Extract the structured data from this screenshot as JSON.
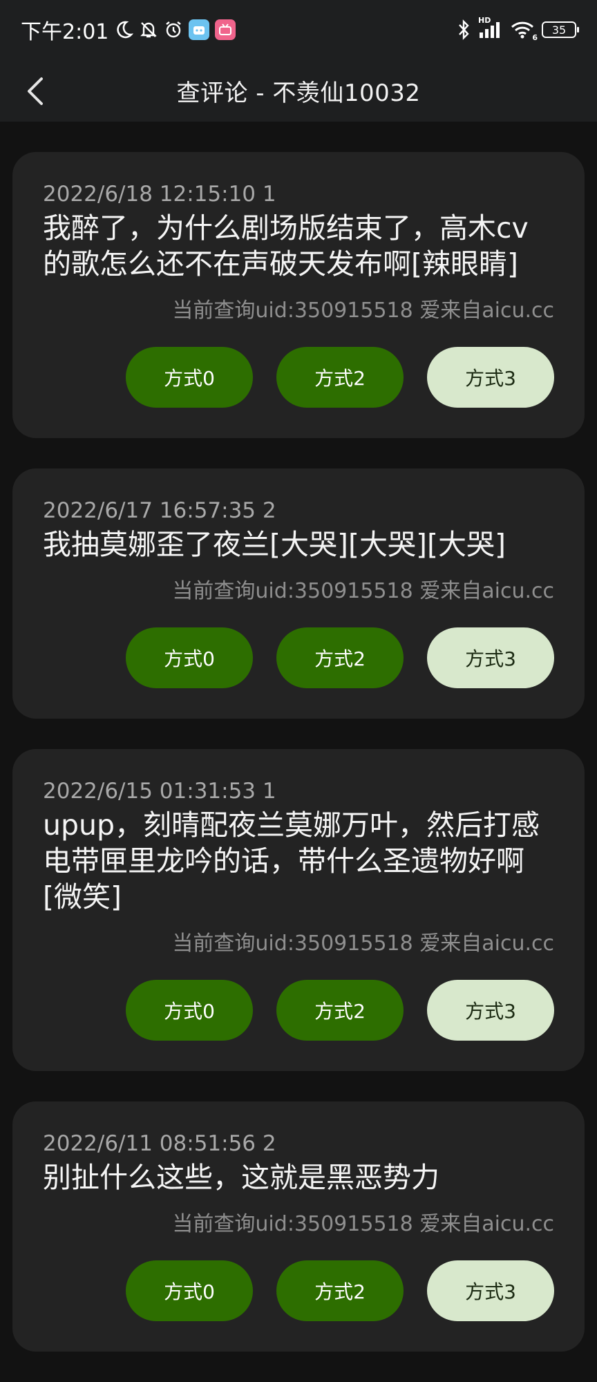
{
  "status_bar": {
    "time": "下午2:01",
    "icons_left": [
      "moon-icon",
      "bell-off-icon",
      "alarm-icon",
      "app-icon-blue",
      "bilibili-icon"
    ],
    "icons_right": [
      "bluetooth-icon",
      "signal-icon",
      "wifi-icon"
    ],
    "signal_label": "HD",
    "wifi_badge": "6",
    "battery": "35"
  },
  "header": {
    "back_icon": "chevron-left-icon",
    "title": "查评论 - 不羡仙10032"
  },
  "comments": [
    {
      "meta": "2022/6/18 12:15:10 1",
      "text": "我醉了，为什么剧场版结束了，高木cv的歌怎么还不在声破天发布啊[辣眼睛]",
      "source": "当前查询uid:350915518 爱来自aicu.cc",
      "buttons": [
        "方式0",
        "方式2",
        "方式3"
      ]
    },
    {
      "meta": "2022/6/17 16:57:35 2",
      "text": "我抽莫娜歪了夜兰[大哭][大哭][大哭]",
      "source": "当前查询uid:350915518 爱来自aicu.cc",
      "buttons": [
        "方式0",
        "方式2",
        "方式3"
      ]
    },
    {
      "meta": "2022/6/15 01:31:53 1",
      "text": "upup，刻晴配夜兰莫娜万叶，然后打感电带匣里龙吟的话，带什么圣遗物好啊[微笑]",
      "source": "当前查询uid:350915518 爱来自aicu.cc",
      "buttons": [
        "方式0",
        "方式2",
        "方式3"
      ]
    },
    {
      "meta": "2022/6/11 08:51:56 2",
      "text": "别扯什么这些，这就是黑恶势力",
      "source": "当前查询uid:350915518 爱来自aicu.cc",
      "buttons": [
        "方式0",
        "方式2",
        "方式3"
      ]
    }
  ],
  "colors": {
    "background": "#121212",
    "card": "#232323",
    "button_green": "#2d6e00",
    "button_light": "#d8e8cc"
  }
}
